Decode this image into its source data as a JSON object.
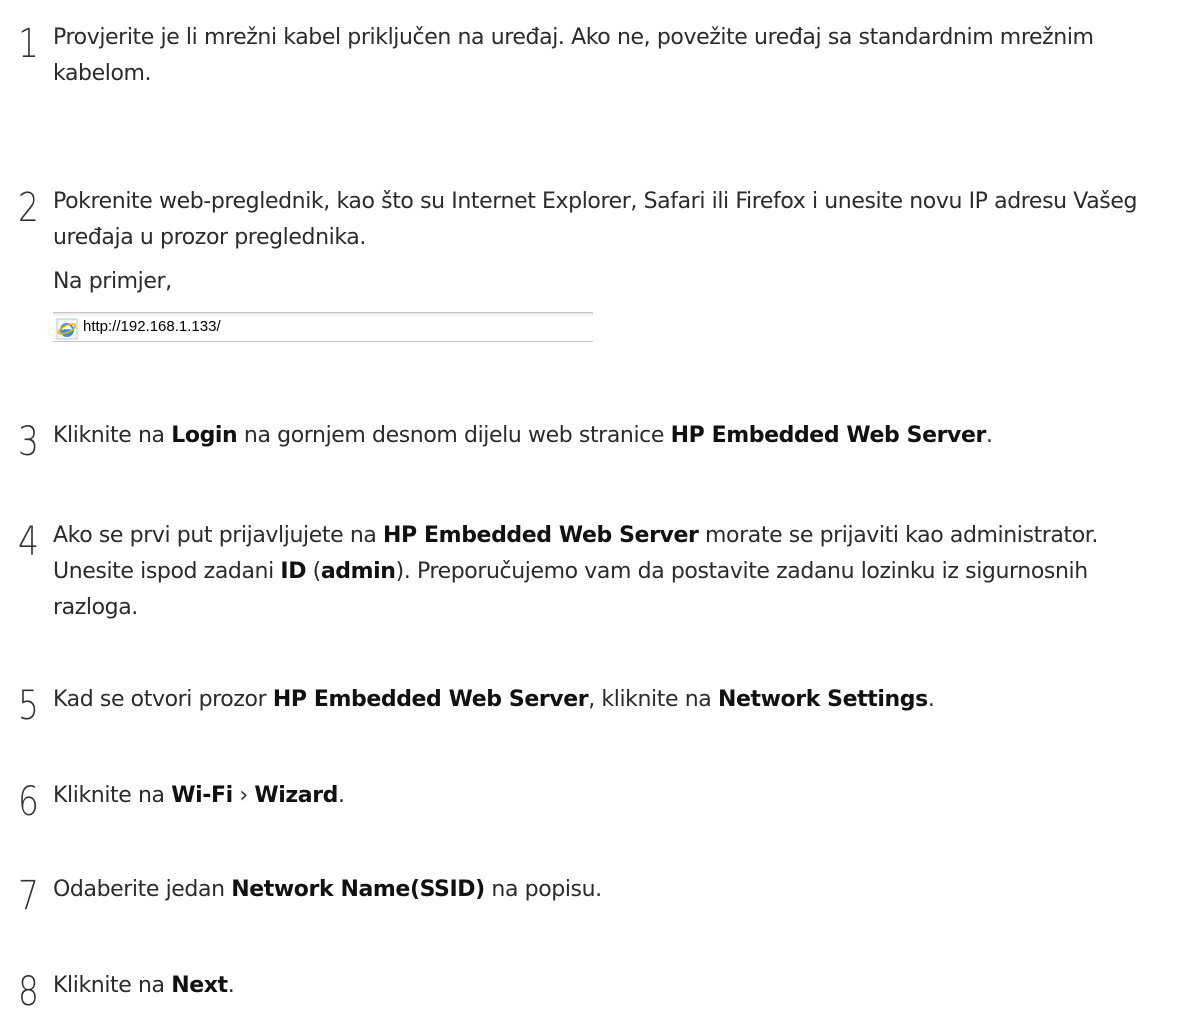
{
  "steps": [
    {
      "number": "1",
      "text": "Provjerite je li mrežni kabel priključen na uređaj. Ako ne, povežite uređaj sa standardnim mrežnim kabelom."
    },
    {
      "number": "2",
      "text": "Pokrenite web-preglednik, kao što su Internet Explorer, Safari ili Firefox i unesite novu IP adresu Vašeg uređaja u prozor preglednika.",
      "example_label": "Na primjer,",
      "example_url": "http://192.168.1.133/",
      "icon": "internet-explorer-icon"
    },
    {
      "number": "3",
      "t1": "Kliknite na ",
      "b1": "Login",
      "t2": " na gornjem desnom dijelu web stranice ",
      "b2": "HP Embedded Web Server",
      "t3": "."
    },
    {
      "number": "4",
      "t1": "Ako se prvi put prijavljujete na ",
      "b1": "HP Embedded Web Server",
      "t2": " morate se prijaviti kao administrator. Unesite ispod zadani ",
      "b2": "ID",
      "t3": " (",
      "b3": "admin",
      "t4": "). Preporučujemo vam da postavite zadanu lozinku iz sigurnosnih razloga."
    },
    {
      "number": "5",
      "t1": "Kad se otvori prozor ",
      "b1": "HP Embedded Web Server",
      "t2": ", kliknite na ",
      "b2": "Network Settings",
      "t3": "."
    },
    {
      "number": "6",
      "t1": "Kliknite na ",
      "b1": "Wi-Fi",
      "t2": " › ",
      "b2": "Wizard",
      "t3": "."
    },
    {
      "number": "7",
      "t1": "Odaberite jedan ",
      "b1": "Network Name(SSID)",
      "t2": " na popisu."
    },
    {
      "number": "8",
      "t1": "Kliknite na ",
      "b1": "Next",
      "t2": "."
    }
  ]
}
